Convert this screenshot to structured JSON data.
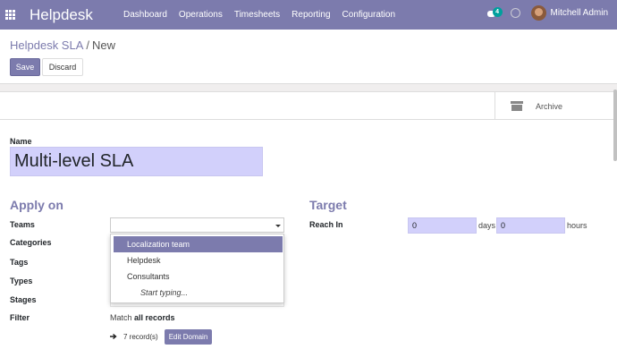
{
  "navbar": {
    "brand": "Helpdesk",
    "menu": [
      "Dashboard",
      "Operations",
      "Timesheets",
      "Reporting",
      "Configuration"
    ],
    "chat_badge": "4",
    "user_name": "Mitchell Admin"
  },
  "breadcrumb": {
    "parent": "Helpdesk SLA",
    "separator": "/",
    "current": "New"
  },
  "buttons": {
    "save": "Save",
    "discard": "Discard",
    "archive": "Archive"
  },
  "form": {
    "name_label": "Name",
    "name_value": "Multi-level SLA",
    "apply_on_title": "Apply on",
    "target_title": "Target",
    "fields": {
      "teams": "Teams",
      "categories": "Categories",
      "tags": "Tags",
      "types": "Types",
      "stages": "Stages",
      "filter": "Filter",
      "reach_in": "Reach In"
    },
    "teams_dropdown": [
      "Localization team",
      "Helpdesk",
      "Consultants"
    ],
    "dropdown_search": "Start typing...",
    "filter_match_prefix": "Match",
    "filter_match_bold": "all records",
    "records_count": "7 record(s)",
    "edit_domain": "Edit Domain",
    "days_value": "0",
    "days_unit": "days",
    "hours_value": "0",
    "hours_unit": "hours"
  },
  "colors": {
    "brand": "#7c7bad",
    "input_highlight": "#d2d0fb",
    "badge": "#00a09d"
  }
}
